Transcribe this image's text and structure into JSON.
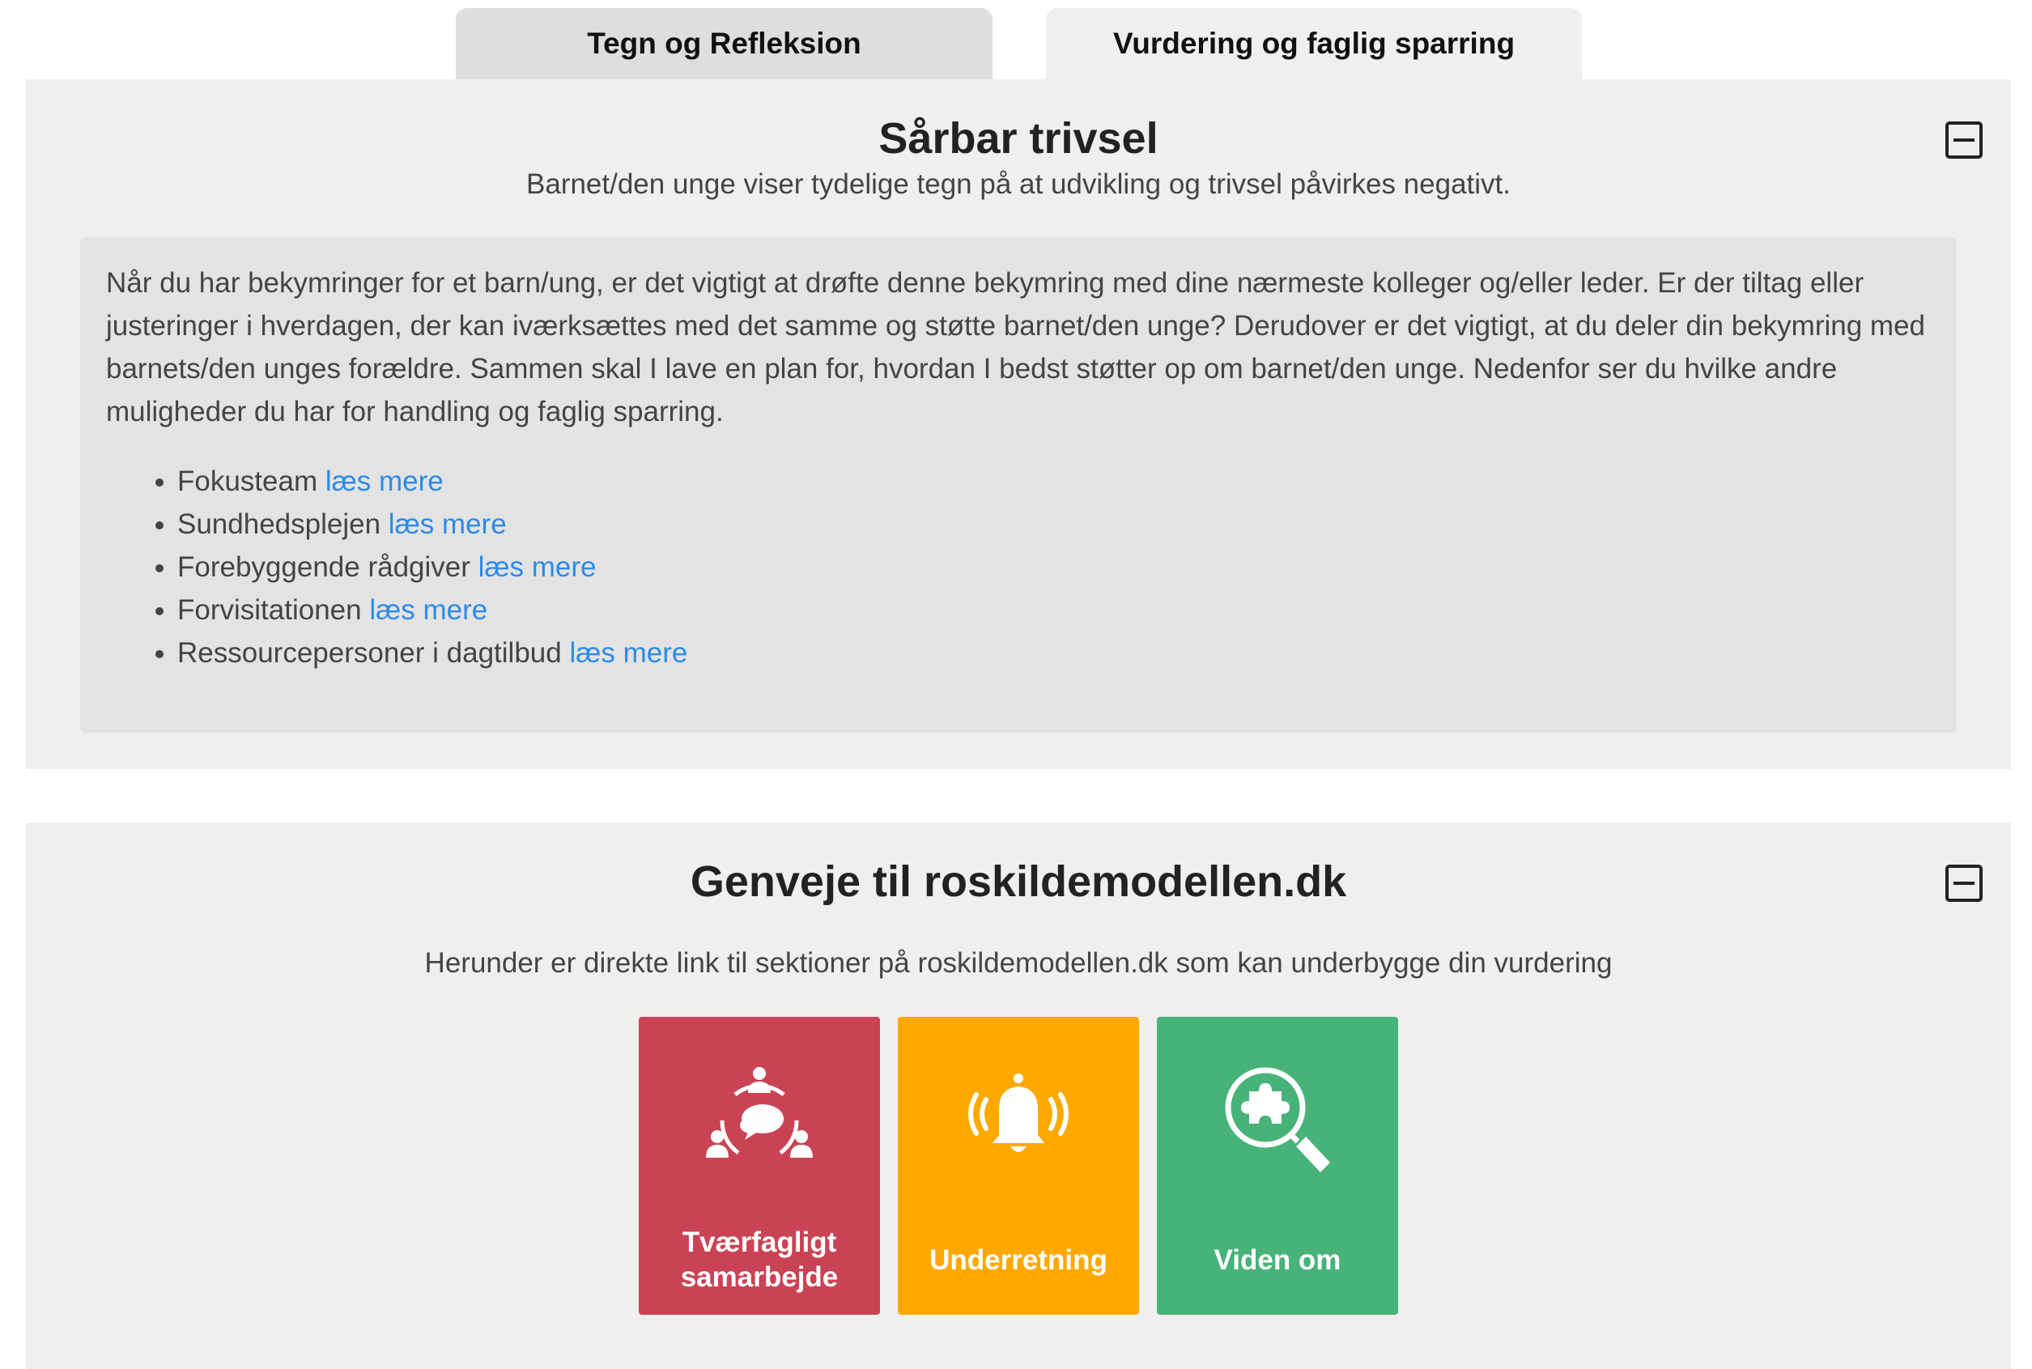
{
  "tabs": [
    {
      "label": "Tegn og Refleksion"
    },
    {
      "label": "Vurdering og faglig sparring"
    }
  ],
  "section1": {
    "title": "Sårbar trivsel",
    "subtitle": "Barnet/den unge viser tydelige tegn på at udvikling og trivsel påvirkes negativt.",
    "collapse_icon": "minus-square-icon",
    "body": "Når du har bekymringer for et barn/ung, er det vigtigt at drøfte denne bekymring med dine nærmeste kolleger og/eller leder. Er der tiltag eller justeringer i hverdagen, der kan iværksættes med det samme og støtte barnet/den unge? Derudover er det vigtigt, at du deler din bekymring med barnets/den unges forældre. Sammen skal I lave en plan for, hvordan I bedst støtter op om barnet/den unge. Nedenfor ser du hvilke andre muligheder du har for handling og faglig sparring.",
    "items": [
      {
        "label": "Fokusteam",
        "link": "læs mere"
      },
      {
        "label": "Sundhedsplejen",
        "link": "læs mere"
      },
      {
        "label": "Forebyggende rådgiver",
        "link": "læs mere"
      },
      {
        "label": "Forvisitationen",
        "link": "læs mere"
      },
      {
        "label": "Ressourcepersoner i dagtilbud",
        "link": "læs mere"
      }
    ]
  },
  "section2": {
    "title": "Genveje til roskildemodellen.dk",
    "subtitle": "Herunder er direkte link til sektioner på roskildemodellen.dk som kan underbygge din vurdering",
    "collapse_icon": "minus-square-icon",
    "tiles": [
      {
        "label": "Tværfagligt\nsamarbejde",
        "icon": "collaboration-icon",
        "color": "#c94355"
      },
      {
        "label": "Underretning",
        "icon": "bell-alert-icon",
        "color": "#ffa800"
      },
      {
        "label": "Viden om",
        "icon": "magnifier-puzzle-icon",
        "color": "#48b379"
      }
    ]
  },
  "colors": {
    "link": "#2b8be8",
    "panel_bg": "#efefef",
    "info_bg": "#e3e3e3"
  }
}
